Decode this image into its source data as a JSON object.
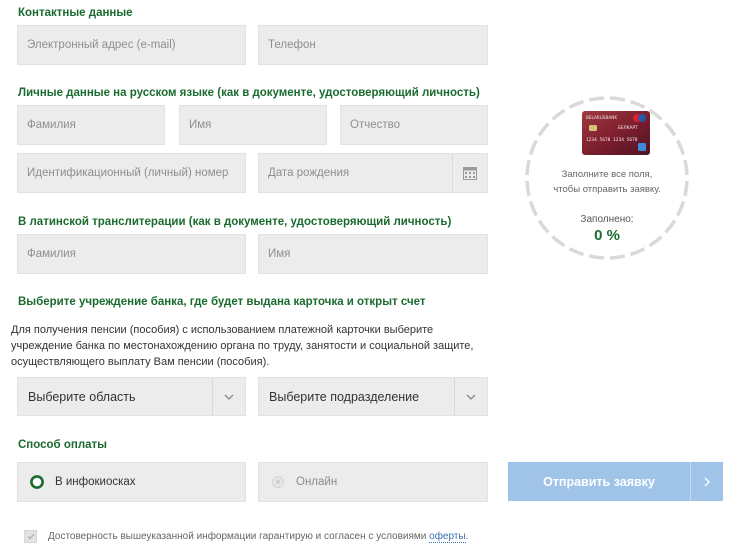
{
  "contacts": {
    "title": "Контактные данные",
    "email_placeholder": "Электронный адрес (e-mail)",
    "phone_placeholder": "Телефон"
  },
  "personal_ru": {
    "title": "Личные данные на русском языке (как в документе, удостоверяющий личность)",
    "lastname_placeholder": "Фамилия",
    "firstname_placeholder": "Имя",
    "patronymic_placeholder": "Отчество",
    "id_number_placeholder": "Идентификационный (личный) номер",
    "birthdate_placeholder": "Дата рождения"
  },
  "personal_lat": {
    "title": "В латинской транслитерации (как в документе, удостоверяющий личность)",
    "lastname_placeholder": "Фамилия",
    "firstname_placeholder": "Имя"
  },
  "bank": {
    "title": "Выберите учреждение банка, где будет выдана карточка и открыт счет",
    "note": "Для получения пенсии (пособия) с использованием платежной карточки выберите учреждение банка по местонахождению органа по труду, занятости и социальной защите, осуществляющего выплату Вам пенсии (пособия).",
    "region_select": "Выберите область",
    "branch_select": "Выберите подразделение"
  },
  "payment": {
    "title": "Способ оплаты",
    "options": [
      {
        "label": "В инфокиосках",
        "selected": true
      },
      {
        "label": "Онлайн",
        "selected": false
      }
    ]
  },
  "submit": {
    "label": "Отправить заявку"
  },
  "consent": {
    "text": "Достоверность вышеуказанной информации гарантирую и согласен с условиями ",
    "link": "оферты",
    "end": ".",
    "checked": true
  },
  "status": {
    "hint": "Заполните все поля, чтобы отправить заявку.",
    "filled_label": "Заполнено:",
    "filled_value": "0 %",
    "progress_fraction": 0
  },
  "card": {
    "bank_name": "BELARUSBANK",
    "card_brand": "БЕЛКАРТ",
    "card_number": "1234 5678 1234 5678"
  },
  "colors": {
    "accent_green": "#1a6b2f",
    "submit_disabled": "#9fc4e8",
    "field_bg": "#ececec"
  }
}
